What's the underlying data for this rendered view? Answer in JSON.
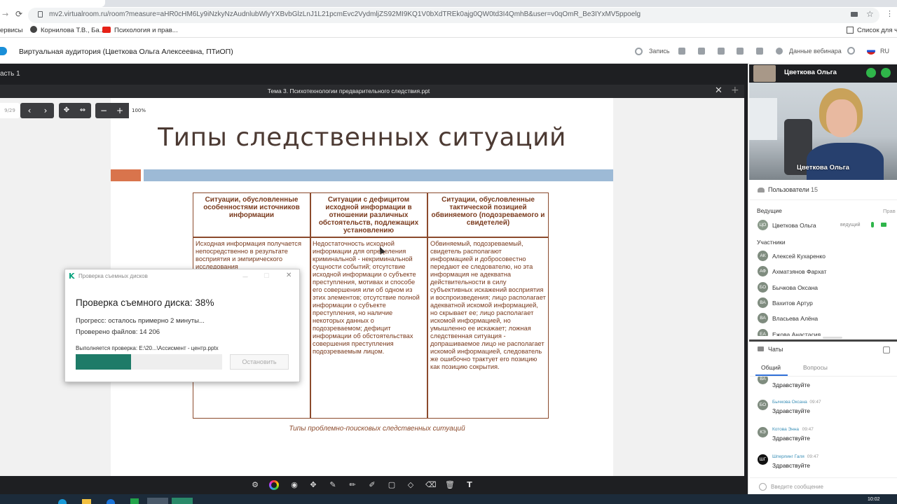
{
  "browser": {
    "url": "mv2.virtualroom.ru/room?measure=aHR0cHM6Ly9iNzkyNzAudnlubWlyYXBvbGlzLnJ1L21pcmEvc2VydmljZS92MI9KQ1V0bXdTREk0ajg0QW0td3I4QmhB&user=v0qOmR_Be3IYxMV5ppoelg",
    "bookmarks": [
      "ервисы",
      "Корнилова Т.В., Ба...",
      "Психология и прав..."
    ],
    "reading_list": "Список для чт"
  },
  "app": {
    "title": "Виртуальная аудитория (Цветкова Ольга Алексеевна, ПТиОП)",
    "record_label": "Запись",
    "webinar_data_label": "Данные вебинара",
    "lang": "RU",
    "part_label": "асть 1"
  },
  "document": {
    "title": "Тема 3. Психотехнологии предварительного следствия.ppt",
    "page": "9/29",
    "zoom": "100%"
  },
  "slide": {
    "title": "Типы следственных ситуаций",
    "headers": [
      "Ситуации, обусловленные особенностями источников информации",
      "Ситуации с дефицитом исходной информации в отношении различных обстоятельств, подлежащих установлению",
      "Ситуации, обусловленные тактической позицией обвиняемого (подозреваемого и свидетелей)"
    ],
    "col1": "Исходная информация получается непосредственно в результате восприятия и эмпирического исследования",
    "col2": "Недостаточность исходной информации для определения криминальной - некриминальной сущности событий; отсутствие исходной информации о субъекте преступления, мотивах и способе его совершения или об одном из этих элементов; отсутствие полной информации о субъекте преступления, но наличие некоторых данных о подозреваемом; дефицит информации об обстоятельствах совершения преступления подозреваемым лицом.",
    "col3": "Обвиняемый, подозреваемый, свидетель располагают информацией и добросовестно передают ее следователю, но эта информация не адекватна действительности в силу субъективных искажений восприятия и воспроизведения; лицо располагает адекватной искомой информацией, но скрывает ее; лицо располагает искомой информацией, но умышленно ее искажает; ложная следственная ситуация - допрашиваемое лицо не располагает искомой информацией, следователь же ошибочно трактует его позицию как позицию сокрытия.",
    "caption": "Типы проблемно-поисковых следственных ситуаций"
  },
  "dialog": {
    "title": "Проверка съемных дисков",
    "heading": "Проверка съемного диска: 38%",
    "progress": 0.38,
    "progress_text": "Прогресс: осталось примерно 2 минуты...",
    "files_text": "Проверено файлов: 14 206",
    "path_text": "Выполняется проверка: E:\\20...\\Ассисмент - центр.pptx",
    "stop_label": "Остановить",
    "accent": "#1e7b68"
  },
  "panel": {
    "presenter_name": "Цветкова Ольга",
    "video_label": "Цветкова Ольга",
    "users_label": "Пользователи",
    "users_count": "15",
    "hosts_label": "Ведущие",
    "hosts_right": "Прав",
    "host": {
      "initials": "ЦО",
      "name": "Цветкова Ольга",
      "role": "ведущий"
    },
    "participants_label": "Участники",
    "participants": [
      {
        "initials": "АК",
        "name": "Алексей Кухаренко"
      },
      {
        "initials": "АФ",
        "name": "Ахматзянов Фархат"
      },
      {
        "initials": "БО",
        "name": "Бычкова Оксана"
      },
      {
        "initials": "ВА",
        "name": "Вахитов Артур"
      },
      {
        "initials": "ВА",
        "name": "Власьева Алёна"
      },
      {
        "initials": "ЕА",
        "name": "Ежова Анастасия"
      }
    ],
    "chats_label": "Чаты",
    "chat_tabs": [
      "Общий",
      "Вопросы"
    ],
    "messages": [
      {
        "initials": "ВА",
        "name": "",
        "time": "",
        "text": "Здравствуйте"
      },
      {
        "initials": "БО",
        "name": "Бычкова Оксана",
        "time": "09:47",
        "text": "Здравствуйте"
      },
      {
        "initials": "КЭ",
        "name": "Котова Энна",
        "time": "09:47",
        "text": "Здравствуйте"
      },
      {
        "initials": "ШГ",
        "name": "Шперлинг Галя",
        "time": "09:47",
        "text": "Здравствуйте"
      }
    ],
    "input_placeholder": "Введите сообщение"
  },
  "taskbar": {
    "time": "10:02"
  }
}
